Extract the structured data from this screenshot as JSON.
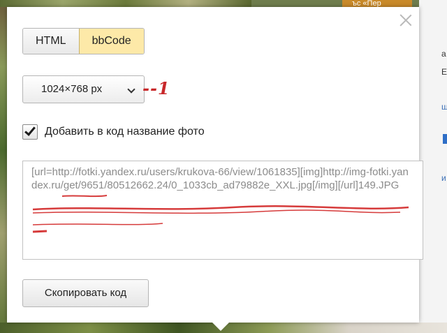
{
  "background": {
    "orange_label": "ъс «Пер",
    "right_fragments": [
      "а",
      "Е",
      "ш",
      "и"
    ]
  },
  "dialog": {
    "format_tabs": [
      {
        "label": "HTML",
        "active": false
      },
      {
        "label": "bbCode",
        "active": true
      }
    ],
    "size_select": {
      "value": "1024×768 px"
    },
    "annotation": "--1",
    "include_title": {
      "label": "Добавить в код название фото",
      "checked": true
    },
    "code_text": "[url=http://fotki.yandex.ru/users/krukova-66/view/1061835][img]http://img-fotki.yandex.ru/get/9651/80512662.24/0_1033cb_ad79882e_XXL.jpg[/img][/url]149.JPG",
    "copy_button": "Скопировать код"
  },
  "colors": {
    "active_tab": "#fde9a8",
    "annotation": "#c8282a",
    "code_text": "#8c8c8c"
  }
}
